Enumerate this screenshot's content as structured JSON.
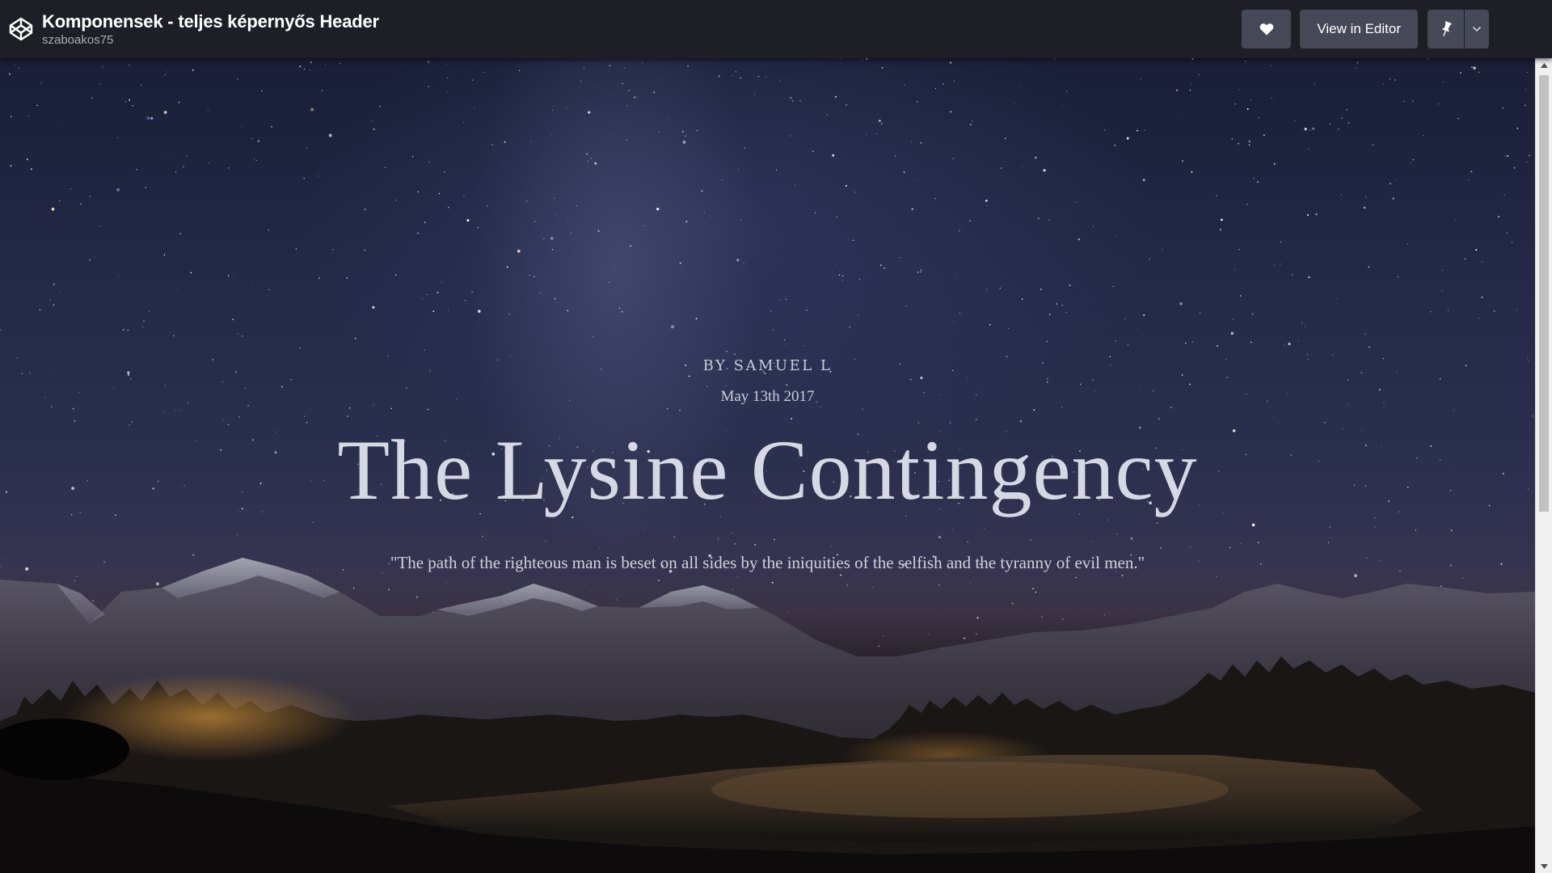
{
  "header": {
    "title": "Komponensek - teljes képernyős Header",
    "author": "szaboakos75",
    "logo_icon": "codepen-logo-icon",
    "buttons": {
      "heart_icon": "heart-icon",
      "editor_label": "View in Editor",
      "pin_icon": "pin-icon",
      "dropdown_icon": "chevron-down-icon"
    },
    "colors": {
      "bar": "#1e1f26",
      "button": "#444857"
    }
  },
  "hero": {
    "byline": "BY SAMUEL L",
    "date": "May 13th 2017",
    "headline": "The Lysine Contingency",
    "quote": "\"The path of the righteous man is beset on all sides by the iniquities of the selfish and the tyranny of evil men.\""
  },
  "scrollbar": {
    "up_icon": "scroll-up-arrow-icon",
    "down_icon": "scroll-down-arrow-icon"
  }
}
